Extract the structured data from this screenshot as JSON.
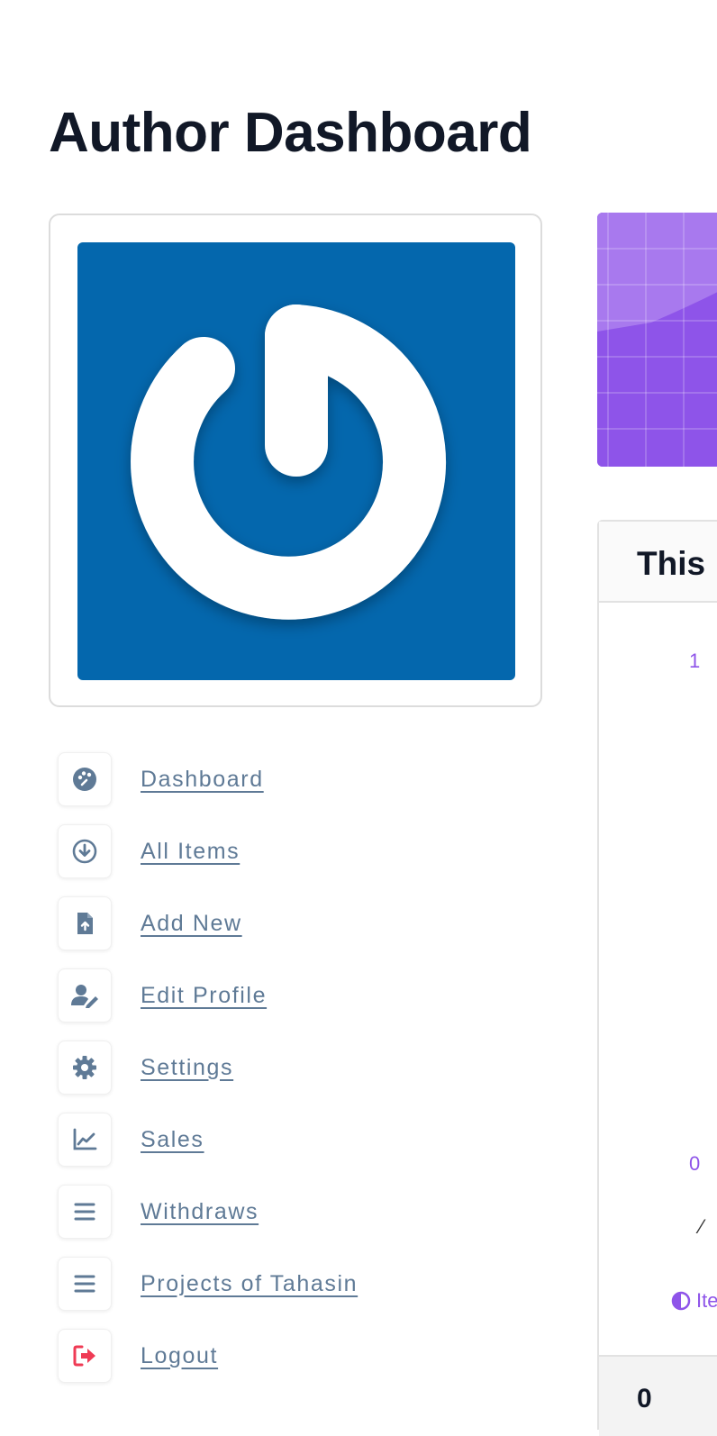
{
  "page": {
    "title": "Author Dashboard"
  },
  "colors": {
    "avatar_bg": "#0467ad",
    "accent": "#8e54e9",
    "nav_text": "#5f7a96",
    "logout": "#ef3b55"
  },
  "nav": {
    "items": [
      {
        "label": "Dashboard",
        "icon": "palette-icon"
      },
      {
        "label": "All Items",
        "icon": "circle-download-icon"
      },
      {
        "label": "Add New",
        "icon": "file-upload-icon"
      },
      {
        "label": "Edit Profile",
        "icon": "user-edit-icon"
      },
      {
        "label": "Settings",
        "icon": "gear-icon"
      },
      {
        "label": "Sales",
        "icon": "line-chart-icon"
      },
      {
        "label": "Withdraws",
        "icon": "bars-icon"
      },
      {
        "label": "Projects of Tahasin",
        "icon": "bars-icon"
      },
      {
        "label": "Logout",
        "icon": "sign-out-icon"
      }
    ]
  },
  "chart_card": {
    "title": "This",
    "ticks": [
      "1",
      "0"
    ],
    "legend": "Ite",
    "footer_value": "0"
  }
}
